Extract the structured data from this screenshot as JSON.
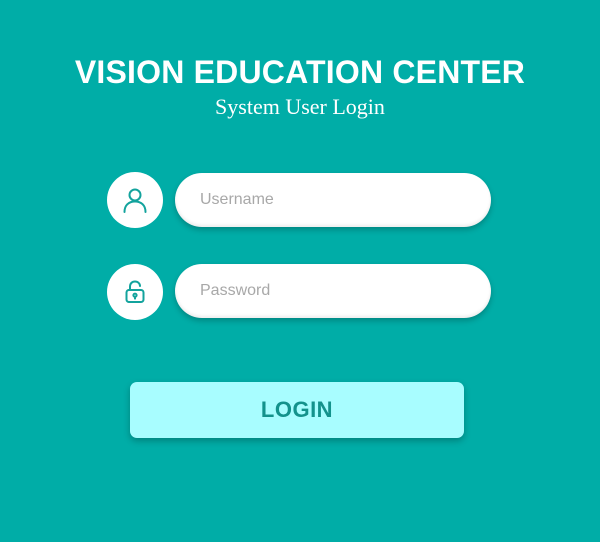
{
  "header": {
    "title": "VISION EDUCATION CENTER",
    "subtitle": "System User Login"
  },
  "form": {
    "username": {
      "placeholder": "Username",
      "value": "",
      "icon": "user-icon"
    },
    "password": {
      "placeholder": "Password",
      "value": "",
      "icon": "lock-icon"
    },
    "login_label": "LOGIN"
  },
  "colors": {
    "background": "#00ada7",
    "accent": "#13928c",
    "button": "#a8fdff",
    "field": "#ffffff"
  }
}
